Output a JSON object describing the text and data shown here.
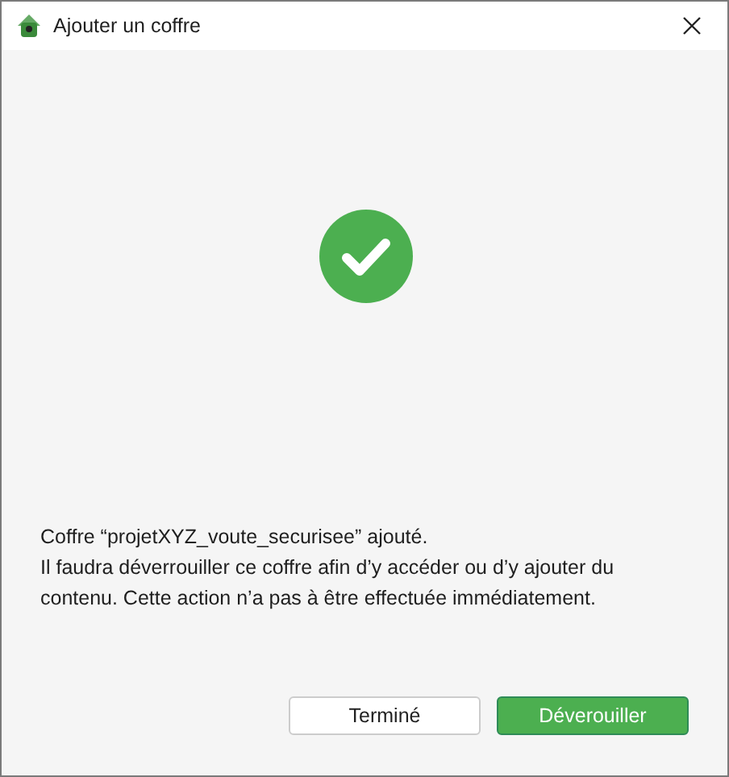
{
  "window": {
    "title": "Ajouter un coffre"
  },
  "status": {
    "kind": "success"
  },
  "message": [
    "Coffre “projetXYZ_voute_securisee” ajouté.",
    "Il faudra déverrouiller ce coffre afin d’y accéder ou d’y ajouter du contenu. Cette action n’a pas à être effectuée immédiatement."
  ],
  "buttons": [
    {
      "label": "Terminé",
      "kind": "secondary"
    },
    {
      "label": "Déverouiller",
      "kind": "primary"
    }
  ]
}
